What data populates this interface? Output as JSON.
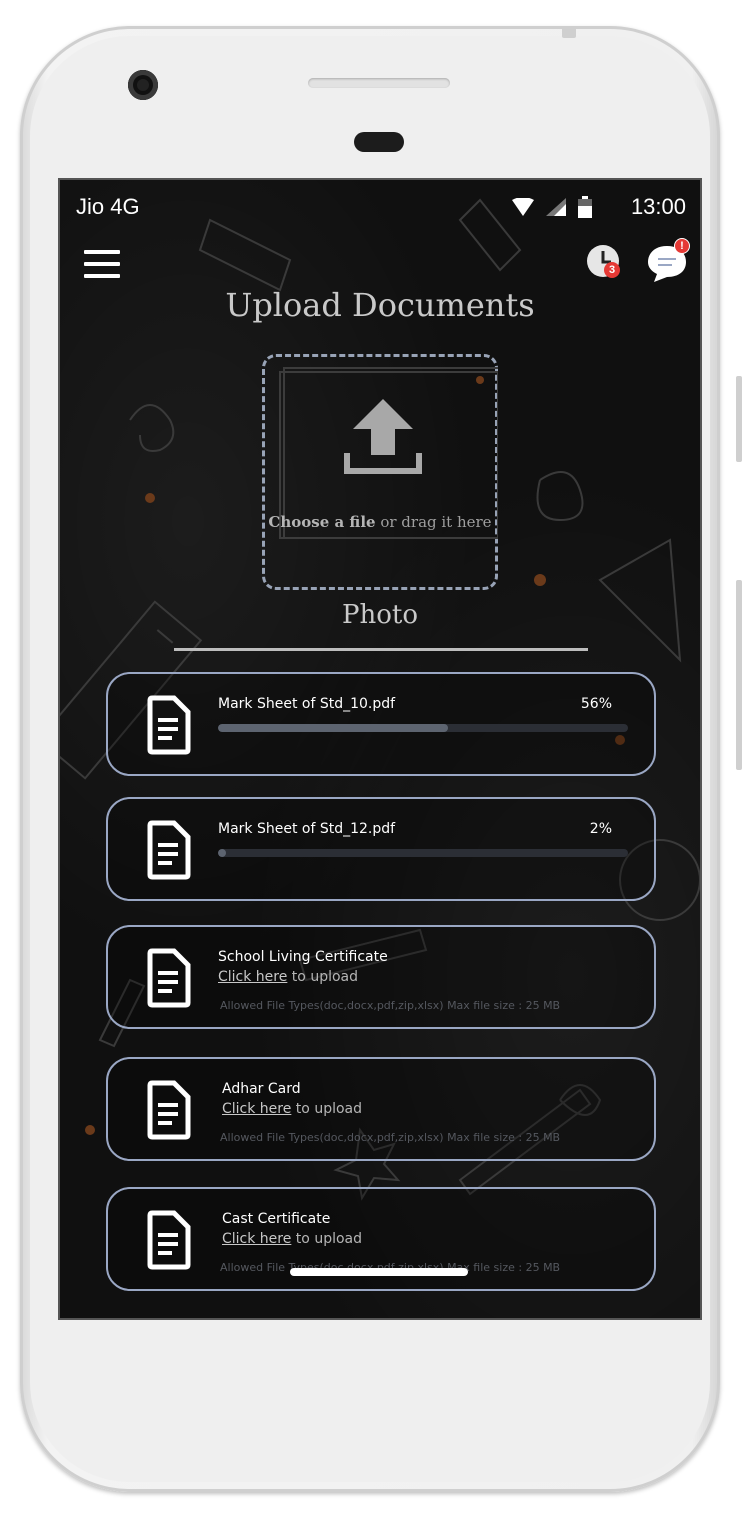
{
  "status_bar": {
    "carrier": "Jio 4G",
    "time": "13:00",
    "icons": [
      "wifi-icon",
      "signal-icon",
      "battery-icon"
    ]
  },
  "header": {
    "menu_icon": "hamburger-menu-icon",
    "history_badge": "3",
    "chat_badge": "!"
  },
  "page": {
    "title": "Upload Documents",
    "dropzone": {
      "choose_label": "Choose a file",
      "drag_label": " or drag it here"
    },
    "section_label": "Photo"
  },
  "documents": [
    {
      "name": "Mark Sheet of Std_10.pdf",
      "percent_label": "56%",
      "progress": 0.56
    },
    {
      "name": "Mark Sheet of Std_12.pdf",
      "percent_label": "2%",
      "progress": 0.02
    },
    {
      "name": "School Living Certificate",
      "link_label": "Click here",
      "link_suffix": " to upload",
      "allowed": "Allowed File Types(doc,docx,pdf,zip,xlsx) Max file size : 25 MB"
    },
    {
      "name": "Adhar Card",
      "link_label": "Click here",
      "link_suffix": " to upload",
      "allowed": "Allowed File Types(doc,docx,pdf,zip,xlsx) Max file size : 25 MB"
    },
    {
      "name": "Cast Certificate",
      "link_label": "Click here",
      "link_suffix": " to upload",
      "allowed": "Allowed File Types(doc,docx,pdf,zip,xlsx) Max file size : 25 MB"
    }
  ],
  "colors": {
    "accent_border": "#9aa7c4",
    "background": "#101010",
    "badge": "#e53935"
  }
}
